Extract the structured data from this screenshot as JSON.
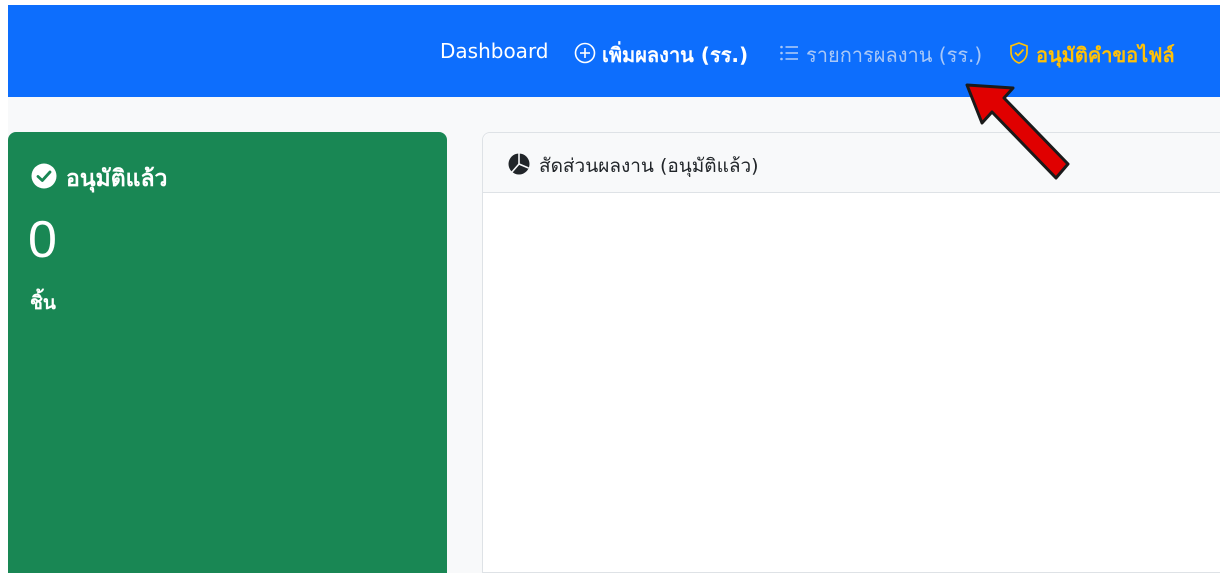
{
  "navbar": {
    "background": "#0d6efd",
    "items": [
      {
        "label": "Dashboard",
        "icon": "",
        "active": false
      },
      {
        "label": "เพิ่มผลงาน (รร.)",
        "icon": "plus-circle-icon",
        "active": false
      },
      {
        "label": "รายการผลงาน (รร.)",
        "icon": "list-icon",
        "active": false
      },
      {
        "label": "อนุมัติคำขอไฟล์",
        "icon": "shield-check-icon",
        "active": true
      }
    ]
  },
  "stat_card": {
    "title": "อนุมัติแล้ว",
    "icon": "check-circle-icon",
    "value": "0",
    "unit": "ชิ้น",
    "color": "#198754"
  },
  "chart_card": {
    "title": "สัดส่วนผลงาน (อนุมัติแล้ว)",
    "icon": "pie-chart-icon"
  },
  "annotation": {
    "type": "red-arrow",
    "points_to": "รายการผลงาน (รร.)",
    "color": "#e00000"
  }
}
